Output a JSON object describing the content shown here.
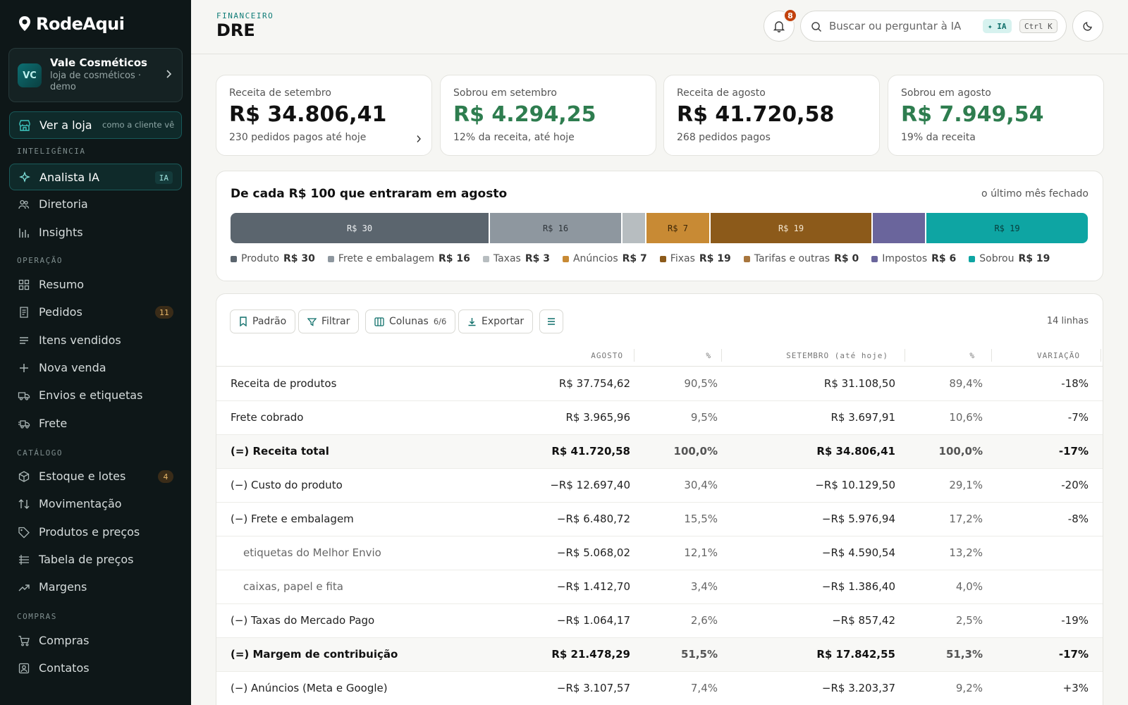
{
  "brand": {
    "name": "RodeAqui"
  },
  "store": {
    "initials": "VC",
    "name": "Vale Cosméticos",
    "subtitle": "loja de cosméticos · demo"
  },
  "view_store": {
    "label": "Ver a loja",
    "hint": "como a cliente vê"
  },
  "sidebar": {
    "sections": [
      {
        "title": "INTELIGÊNCIA",
        "items": [
          {
            "label": "Analista IA",
            "icon": "sparkle-icon",
            "badge": "IA",
            "active": true
          },
          {
            "label": "Diretoria",
            "icon": "users-icon"
          },
          {
            "label": "Insights",
            "icon": "bar-chart-icon"
          }
        ]
      },
      {
        "title": "OPERAÇÃO",
        "items": [
          {
            "label": "Resumo",
            "icon": "grid-icon"
          },
          {
            "label": "Pedidos",
            "icon": "receipt-icon",
            "badge": "11"
          },
          {
            "label": "Itens vendidos",
            "icon": "list-icon"
          },
          {
            "label": "Nova venda",
            "icon": "plus-icon"
          },
          {
            "label": "Envios e etiquetas",
            "icon": "truck-icon"
          },
          {
            "label": "Frete",
            "icon": "fast-truck-icon"
          }
        ]
      },
      {
        "title": "CATÁLOGO",
        "items": [
          {
            "label": "Estoque e lotes",
            "icon": "box-icon",
            "badge": "4"
          },
          {
            "label": "Movimentação",
            "icon": "arrows-updown-icon"
          },
          {
            "label": "Produtos e preços",
            "icon": "tag-icon"
          },
          {
            "label": "Tabela de preços",
            "icon": "table-icon"
          },
          {
            "label": "Margens",
            "icon": "trend-up-icon"
          }
        ]
      },
      {
        "title": "COMPRAS",
        "items": [
          {
            "label": "Compras",
            "icon": "cart-icon"
          },
          {
            "label": "Contatos",
            "icon": "contact-icon"
          }
        ]
      }
    ]
  },
  "header": {
    "eyebrow": "FINANCEIRO",
    "title": "DRE",
    "notifications": "8",
    "search_placeholder": "Buscar ou perguntar à IA",
    "ia_chip": "✦ IA",
    "shortcut": "Ctrl K"
  },
  "kpis": [
    {
      "label": "Receita de setembro",
      "value": "R$ 34.806,41",
      "sub": "230 pedidos pagos até hoje",
      "green": false,
      "chevron": true
    },
    {
      "label": "Sobrou em setembro",
      "value": "R$ 4.294,25",
      "sub": "12% da receita, até hoje",
      "green": true
    },
    {
      "label": "Receita de agosto",
      "value": "R$ 41.720,58",
      "sub": "268 pedidos pagos",
      "green": false
    },
    {
      "label": "Sobrou em agosto",
      "value": "R$ 7.949,54",
      "sub": "19% da receita",
      "green": true
    }
  ],
  "breakdown": {
    "title": "De cada R$ 100 que entraram em agosto",
    "note": "o último mês fechado",
    "segments": [
      {
        "name": "Produto",
        "value": 30,
        "label": "R$ 30",
        "legend_value": "R$ 30",
        "color": "#5b656e",
        "text_color": "#eef0f2"
      },
      {
        "name": "Frete e embalagem",
        "value": 16,
        "label": "R$ 16",
        "legend_value": "R$ 16",
        "color": "#8e979f",
        "text_color": "#2f353a"
      },
      {
        "name": "Taxas",
        "value": 3,
        "label": "",
        "legend_value": "R$ 3",
        "color": "#b7bdc0",
        "text_color": "#333"
      },
      {
        "name": "Anúncios",
        "value": 7,
        "label": "R$ 7",
        "legend_value": "R$ 7",
        "color": "#c88a34",
        "text_color": "#3b2506"
      },
      {
        "name": "Fixas",
        "value": 19,
        "label": "R$ 19",
        "legend_value": "R$ 19",
        "color": "#8c5a1a",
        "text_color": "#f4e6cf"
      },
      {
        "name": "Tarifas e outras",
        "value": 0,
        "label": "",
        "legend_value": "R$ 0",
        "color": "#a8763d",
        "text_color": "#fff"
      },
      {
        "name": "Impostos",
        "value": 6,
        "label": "",
        "legend_value": "R$ 6",
        "color": "#6a659c",
        "text_color": "#fff"
      },
      {
        "name": "Sobrou",
        "value": 19,
        "label": "R$ 19",
        "legend_value": "R$ 19",
        "color": "#0ea5a3",
        "text_color": "#083e3d"
      }
    ]
  },
  "table": {
    "toolbar": {
      "default": "Padrão",
      "filter": "Filtrar",
      "columns": "Colunas",
      "columns_count": "6/6",
      "export": "Exportar"
    },
    "row_count": "14 linhas",
    "headers": [
      "AGOSTO",
      "%",
      "SETEMBRO (até hoje)",
      "%",
      "VARIAÇÃO"
    ],
    "rows": [
      {
        "label": "Receita de produtos",
        "aug": "R$ 37.754,62",
        "aug_pct": "90,5%",
        "sep": "R$ 31.108,50",
        "sep_pct": "89,4%",
        "var": "-18%"
      },
      {
        "label": "Frete cobrado",
        "aug": "R$ 3.965,96",
        "aug_pct": "9,5%",
        "sep": "R$ 3.697,91",
        "sep_pct": "10,6%",
        "var": "-7%"
      },
      {
        "label": "(=) Receita total",
        "aug": "R$ 41.720,58",
        "aug_pct": "100,0%",
        "sep": "R$ 34.806,41",
        "sep_pct": "100,0%",
        "var": "-17%",
        "total": true
      },
      {
        "label": "(−) Custo do produto",
        "aug": "−R$ 12.697,40",
        "aug_pct": "30,4%",
        "sep": "−R$ 10.129,50",
        "sep_pct": "29,1%",
        "var": "-20%"
      },
      {
        "label": "(−) Frete e embalagem",
        "aug": "−R$ 6.480,72",
        "aug_pct": "15,5%",
        "sep": "−R$ 5.976,94",
        "sep_pct": "17,2%",
        "var": "-8%"
      },
      {
        "label": "etiquetas do Melhor Envio",
        "aug": "−R$ 5.068,02",
        "aug_pct": "12,1%",
        "sep": "−R$ 4.590,54",
        "sep_pct": "13,2%",
        "var": "",
        "sub": true
      },
      {
        "label": "caixas, papel e fita",
        "aug": "−R$ 1.412,70",
        "aug_pct": "3,4%",
        "sep": "−R$ 1.386,40",
        "sep_pct": "4,0%",
        "var": "",
        "sub": true
      },
      {
        "label": "(−) Taxas do Mercado Pago",
        "aug": "−R$ 1.064,17",
        "aug_pct": "2,6%",
        "sep": "−R$ 857,42",
        "sep_pct": "2,5%",
        "var": "-19%"
      },
      {
        "label": "(=) Margem de contribuição",
        "aug": "R$ 21.478,29",
        "aug_pct": "51,5%",
        "sep": "R$ 17.842,55",
        "sep_pct": "51,3%",
        "var": "-17%",
        "total": true
      },
      {
        "label": "(−) Anúncios (Meta e Google)",
        "aug": "−R$ 3.107,57",
        "aug_pct": "7,4%",
        "sep": "−R$ 3.203,37",
        "sep_pct": "9,2%",
        "var": "+3%"
      }
    ]
  }
}
